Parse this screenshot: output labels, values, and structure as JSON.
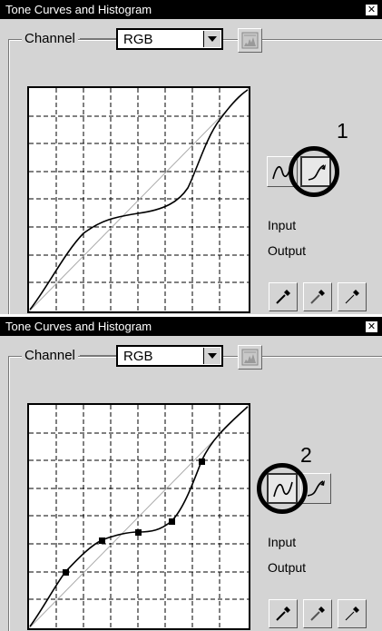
{
  "panels": [
    {
      "title": "Tone Curves and Histogram",
      "close_icon": "close-icon",
      "channel_label": "Channel",
      "channel_value": "RGB",
      "mode": "freehand",
      "callout": "1",
      "input_label": "Input",
      "output_label": "Output"
    },
    {
      "title": "Tone Curves and Histogram",
      "close_icon": "close-icon",
      "channel_label": "Channel",
      "channel_value": "RGB",
      "mode": "point",
      "callout": "2",
      "input_label": "Input",
      "output_label": "Output"
    }
  ],
  "icons": [
    "close-icon",
    "dropdown-arrow-icon",
    "histogram-icon",
    "point-curve-icon",
    "freehand-curve-icon",
    "black-point-eyedropper-icon",
    "gray-point-eyedropper-icon",
    "white-point-eyedropper-icon"
  ]
}
